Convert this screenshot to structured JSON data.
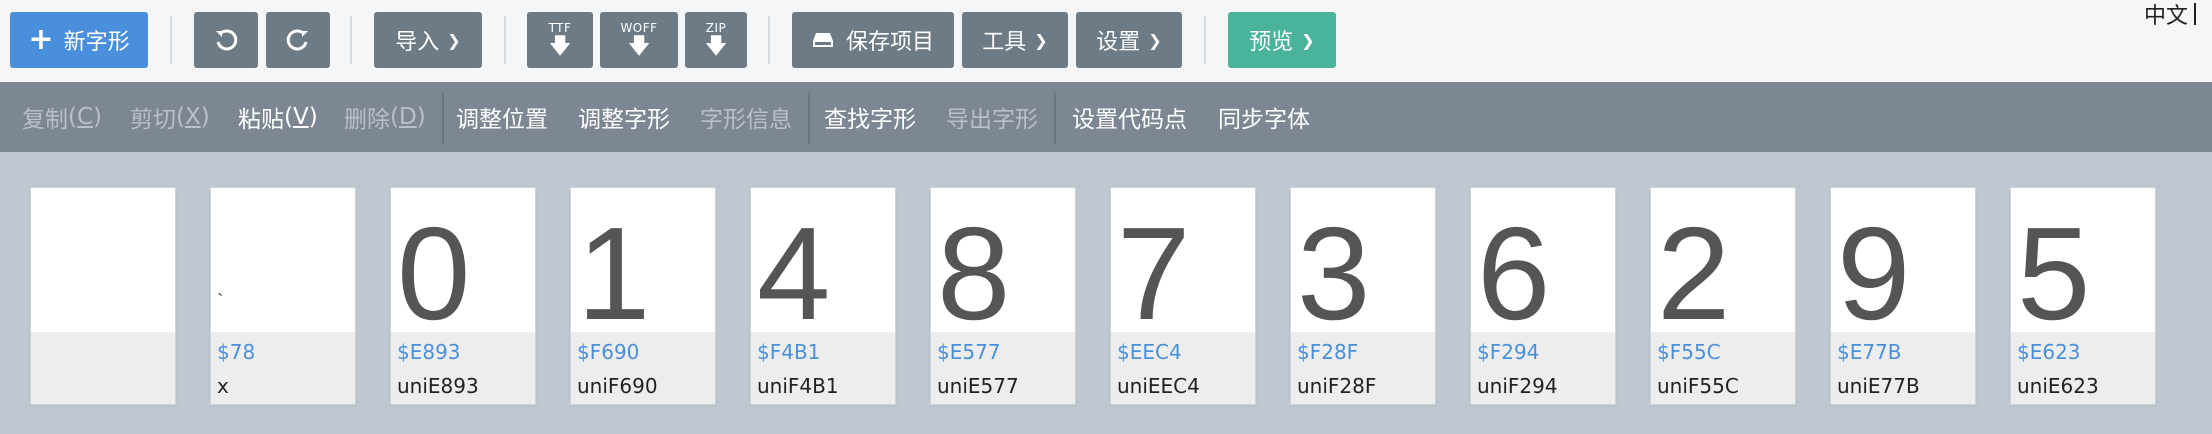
{
  "topbar": {
    "new_glyph": "新字形",
    "undo_icon": "undo-icon",
    "redo_icon": "redo-icon",
    "import": "导入",
    "ttf": "TTF",
    "woff": "WOFF",
    "zip": "ZIP",
    "save_project": "保存项目",
    "tools": "工具",
    "settings": "设置",
    "preview": "预览",
    "language": "中文"
  },
  "toolbar": {
    "copy": "复制",
    "copy_key": "C",
    "cut": "剪切",
    "cut_key": "X",
    "paste": "粘贴",
    "paste_key": "V",
    "delete": "删除",
    "delete_key": "D",
    "adjust_position": "调整位置",
    "adjust_glyph": "调整字形",
    "glyph_info": "字形信息",
    "find_glyph": "查找字形",
    "export_glyph": "导出字形",
    "set_codepoint": "设置代码点",
    "sync_font": "同步字体"
  },
  "glyphs": [
    {
      "char": "",
      "code": "",
      "name": ""
    },
    {
      "char": "`",
      "code": "$78",
      "name": "x"
    },
    {
      "char": "0",
      "code": "$E893",
      "name": "uniE893"
    },
    {
      "char": "1",
      "code": "$F690",
      "name": "uniF690"
    },
    {
      "char": "4",
      "code": "$F4B1",
      "name": "uniF4B1"
    },
    {
      "char": "8",
      "code": "$E577",
      "name": "uniE577"
    },
    {
      "char": "7",
      "code": "$EEC4",
      "name": "uniEEC4"
    },
    {
      "char": "3",
      "code": "$F28F",
      "name": "uniF28F"
    },
    {
      "char": "6",
      "code": "$F294",
      "name": "uniF294"
    },
    {
      "char": "2",
      "code": "$F55C",
      "name": "uniF55C"
    },
    {
      "char": "9",
      "code": "$E77B",
      "name": "uniE77B"
    },
    {
      "char": "5",
      "code": "$E623",
      "name": "uniE623"
    }
  ],
  "colors": {
    "primary": "#4a8fdb",
    "toolbar_bg": "#7c8793",
    "button_gray": "#6d7b86",
    "preview_green": "#49b39b",
    "code_blue": "#4a90d9"
  }
}
